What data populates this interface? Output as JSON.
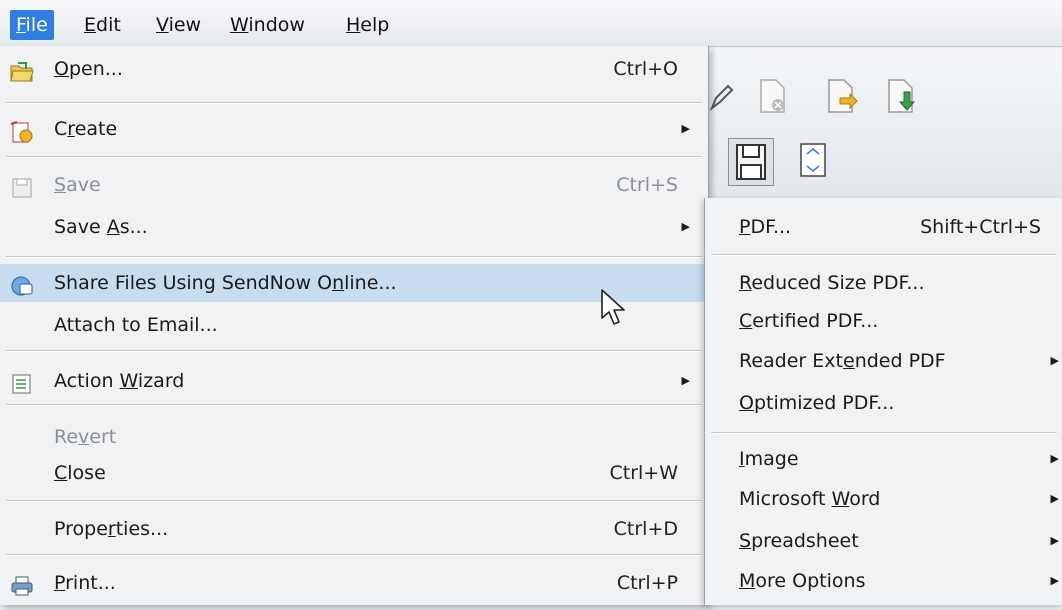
{
  "menubar": {
    "items": [
      {
        "label": "File",
        "access": 0,
        "active": true
      },
      {
        "label": "Edit",
        "access": 0
      },
      {
        "label": "View",
        "access": 0
      },
      {
        "label": "Window",
        "access": 0
      },
      {
        "label": "Help",
        "access": 0
      }
    ]
  },
  "file_menu": {
    "items": [
      {
        "label": "Open...",
        "access": 0,
        "shortcut": "Ctrl+O",
        "icon": "open-folder-icon"
      },
      {
        "label": "Create",
        "access": 1,
        "submenu": true,
        "icon": "create-pdf-icon"
      },
      {
        "label": "Save",
        "access": 0,
        "shortcut": "Ctrl+S",
        "disabled": true,
        "icon": "save-icon"
      },
      {
        "label": "Save As...",
        "access": 5,
        "submenu": true
      },
      {
        "label": "Share Files Using SendNow Online...",
        "access": 27,
        "highlight": true,
        "icon": "sendnow-icon"
      },
      {
        "label": "Attach to Email...",
        "access": 18
      },
      {
        "label": "Action Wizard",
        "access": 7,
        "submenu": true,
        "icon": "action-wizard-icon"
      },
      {
        "label": "Revert",
        "access": 2,
        "disabled": true
      },
      {
        "label": "Close",
        "access": 0,
        "shortcut": "Ctrl+W"
      },
      {
        "label": "Properties...",
        "access": 5,
        "shortcut": "Ctrl+D"
      },
      {
        "label": "Print...",
        "access": 0,
        "shortcut": "Ctrl+P",
        "icon": "printer-icon"
      }
    ]
  },
  "save_as_submenu": {
    "items": [
      {
        "label": "PDF...",
        "access": 0,
        "shortcut": "Shift+Ctrl+S"
      },
      {
        "label": "Reduced Size PDF...",
        "access": 0
      },
      {
        "label": "Certified PDF...",
        "access": 0
      },
      {
        "label": "Reader Extended PDF",
        "access": 10,
        "submenu": true
      },
      {
        "label": "Optimized PDF...",
        "access": 0
      },
      {
        "label": "Image",
        "access": 0,
        "submenu": true
      },
      {
        "label": "Microsoft Word",
        "access": 10,
        "submenu": true
      },
      {
        "label": "Spreadsheet",
        "access": 0,
        "submenu": true
      },
      {
        "label": "More Options",
        "access": 0,
        "submenu": true
      }
    ]
  },
  "colors": {
    "menu_bg": "#f1f2f4",
    "highlight": "#c7dcef",
    "active_menu": "#2e7fe0"
  }
}
